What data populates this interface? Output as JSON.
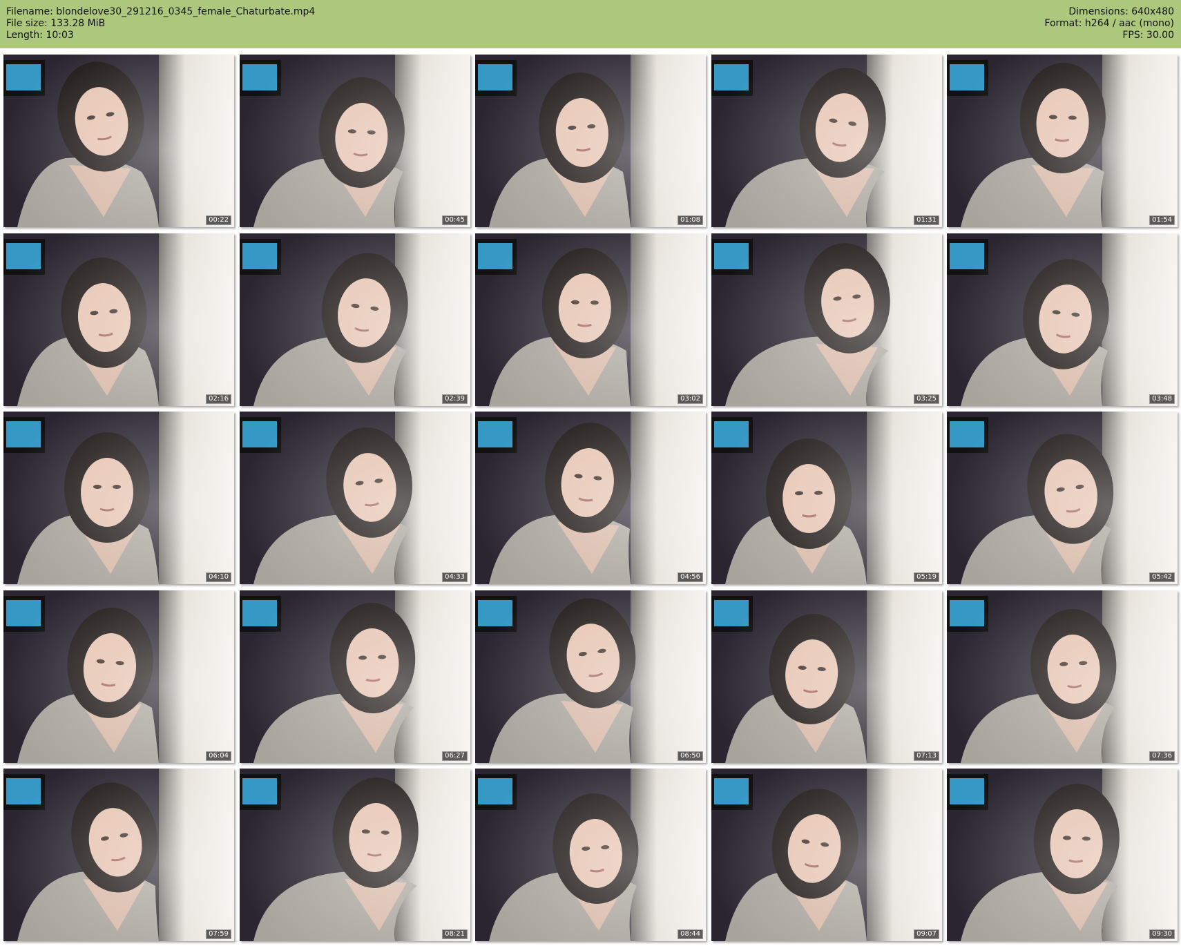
{
  "header": {
    "filename": "Filename: blondelove30_291216_0345_female_Chaturbate.mp4",
    "filesize": "File size: 133.28 MiB",
    "length": "Length: 10:03",
    "dimensions": "Dimensions: 640x480",
    "format": "Format: h264 / aac (mono)",
    "fps": "FPS: 30.00"
  },
  "thumbnails": [
    {
      "time": "00:22"
    },
    {
      "time": "00:45"
    },
    {
      "time": "01:08"
    },
    {
      "time": "01:31"
    },
    {
      "time": "01:54"
    },
    {
      "time": "02:16"
    },
    {
      "time": "02:39"
    },
    {
      "time": "03:02"
    },
    {
      "time": "03:25"
    },
    {
      "time": "03:48"
    },
    {
      "time": "04:10"
    },
    {
      "time": "04:33"
    },
    {
      "time": "04:56"
    },
    {
      "time": "05:19"
    },
    {
      "time": "05:42"
    },
    {
      "time": "06:04"
    },
    {
      "time": "06:27"
    },
    {
      "time": "06:50"
    },
    {
      "time": "07:13"
    },
    {
      "time": "07:36"
    },
    {
      "time": "07:59"
    },
    {
      "time": "08:21"
    },
    {
      "time": "08:44"
    },
    {
      "time": "09:07"
    },
    {
      "time": "09:30"
    }
  ],
  "colors": {
    "header_bg": "#adc87c",
    "room_dark": "#1d1a22",
    "curtain": "#e6e1da",
    "sweater": "#a8a39b",
    "hair": "#1c1614",
    "tv_screen": "#3aa7d9"
  }
}
